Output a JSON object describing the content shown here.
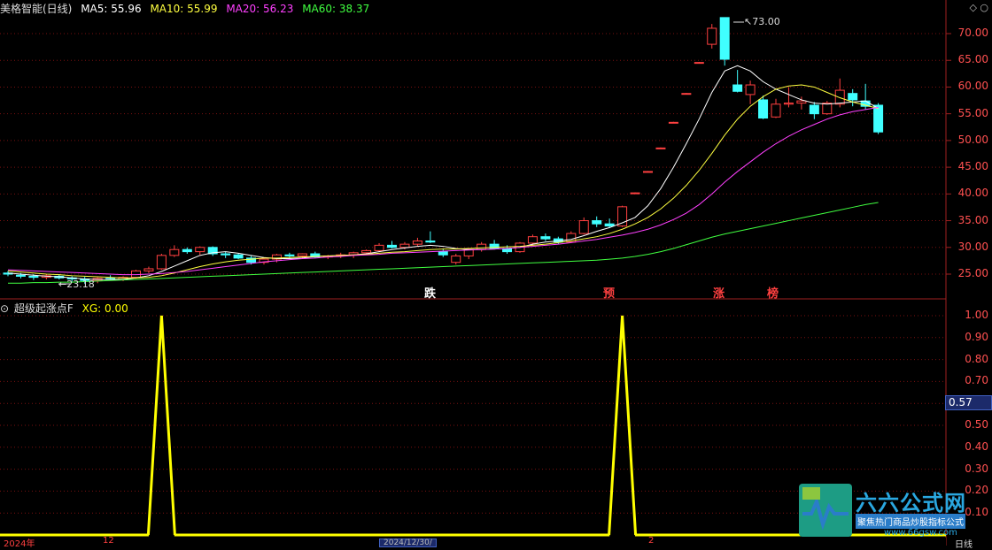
{
  "main_header": {
    "stock_name": "美格智能(日线)",
    "ma5": "MA5: 55.96",
    "ma10": "MA10: 55.99",
    "ma20": "MA20: 56.23",
    "ma60": "MA60: 38.37"
  },
  "sub_header": {
    "indicator": "超级起涨点F",
    "xg": "XG: 0.00"
  },
  "colors": {
    "ma5": "#ffffff",
    "ma10": "#ffff40",
    "ma20": "#ff40ff",
    "ma60": "#40ff40",
    "up": "#ff4040",
    "down": "#40ffff",
    "indicator": "#ffff00",
    "axis": "#ff5050"
  },
  "price_axis": [
    "70.00",
    "65.00",
    "60.00",
    "55.00",
    "50.00",
    "45.00",
    "40.00",
    "35.00",
    "30.00",
    "25.00"
  ],
  "sub_axis": [
    "1.00",
    "0.90",
    "0.80",
    "0.70",
    "0.57",
    "0.50",
    "0.40",
    "0.30",
    "0.20",
    "0.10"
  ],
  "cursor_value": "0.57",
  "high_label": "73.00",
  "low_label": "23.18",
  "annotations": {
    "die": "跌",
    "yu": "预",
    "zhang": "涨",
    "bang": "榜"
  },
  "bottom": {
    "year": "2024年",
    "m12": "12",
    "date": "2024/12/30/",
    "m2": "2",
    "right": "日线"
  },
  "corner": "◇ ○",
  "logo": {
    "title": "六六公式网",
    "sub": "聚焦热门商品炒股指标公式",
    "url": "www.66gsw.com"
  },
  "chart_data": [
    {
      "type": "candlestick",
      "title": "美格智能(日线)",
      "ylim": [
        23,
        73
      ],
      "candles": [
        [
          25.2,
          25.6,
          24.6,
          25.0
        ],
        [
          24.8,
          25.2,
          24.2,
          24.6
        ],
        [
          24.6,
          25.0,
          23.9,
          24.4
        ],
        [
          24.4,
          25.0,
          24.0,
          24.7
        ],
        [
          24.6,
          25.0,
          24.0,
          24.3
        ],
        [
          24.3,
          24.6,
          23.6,
          24.1
        ],
        [
          24.1,
          24.5,
          23.2,
          23.8
        ],
        [
          23.8,
          24.4,
          23.3,
          24.2
        ],
        [
          24.2,
          24.8,
          23.9,
          24.0
        ],
        [
          24.0,
          24.6,
          23.7,
          24.4
        ],
        [
          24.4,
          25.8,
          24.2,
          25.6
        ],
        [
          25.6,
          26.4,
          25.2,
          26.0
        ],
        [
          26.0,
          28.8,
          25.8,
          28.5
        ],
        [
          28.5,
          30.4,
          28.2,
          29.6
        ],
        [
          29.6,
          30.0,
          28.8,
          29.2
        ],
        [
          29.2,
          30.2,
          28.6,
          30.0
        ],
        [
          30.0,
          30.2,
          28.4,
          28.8
        ],
        [
          28.8,
          29.2,
          28.0,
          28.6
        ],
        [
          28.6,
          28.8,
          27.8,
          28.0
        ],
        [
          28.0,
          28.4,
          26.8,
          27.2
        ],
        [
          27.2,
          28.0,
          26.8,
          27.8
        ],
        [
          27.8,
          28.8,
          27.2,
          28.6
        ],
        [
          28.6,
          29.0,
          28.0,
          28.4
        ],
        [
          28.4,
          28.9,
          27.9,
          28.8
        ],
        [
          28.8,
          29.2,
          28.0,
          28.2
        ],
        [
          28.2,
          28.6,
          27.8,
          28.4
        ],
        [
          28.4,
          29.0,
          28.0,
          28.6
        ],
        [
          28.6,
          29.2,
          28.0,
          29.0
        ],
        [
          29.0,
          29.6,
          28.6,
          29.4
        ],
        [
          29.4,
          30.8,
          29.2,
          30.4
        ],
        [
          30.4,
          31.2,
          29.8,
          30.0
        ],
        [
          30.0,
          31.0,
          29.6,
          30.6
        ],
        [
          30.6,
          31.8,
          30.2,
          31.2
        ],
        [
          31.2,
          33.0,
          30.8,
          31.0
        ],
        [
          29.2,
          29.8,
          28.2,
          28.6
        ],
        [
          27.2,
          28.8,
          26.8,
          28.4
        ],
        [
          28.4,
          29.8,
          27.8,
          29.6
        ],
        [
          29.6,
          31.0,
          29.2,
          30.6
        ],
        [
          30.6,
          31.4,
          29.6,
          29.8
        ],
        [
          29.8,
          30.4,
          28.8,
          29.2
        ],
        [
          29.2,
          31.0,
          29.0,
          30.8
        ],
        [
          30.8,
          32.4,
          30.4,
          32.0
        ],
        [
          32.0,
          32.6,
          31.2,
          31.6
        ],
        [
          31.6,
          32.0,
          30.6,
          31.0
        ],
        [
          31.0,
          33.0,
          30.8,
          32.6
        ],
        [
          32.6,
          35.6,
          32.4,
          35.0
        ],
        [
          35.0,
          35.8,
          33.8,
          34.4
        ],
        [
          34.4,
          35.4,
          33.6,
          34.0
        ],
        [
          34.0,
          37.8,
          33.8,
          37.6
        ],
        [
          40.2,
          40.3,
          40.1,
          40.2
        ],
        [
          44.2,
          44.3,
          44.1,
          44.2
        ],
        [
          48.6,
          48.7,
          48.5,
          48.6
        ],
        [
          53.4,
          53.5,
          53.3,
          53.4
        ],
        [
          58.8,
          58.9,
          58.7,
          58.8
        ],
        [
          64.6,
          64.7,
          64.5,
          64.6
        ],
        [
          68.0,
          71.8,
          67.2,
          71.0
        ],
        [
          73.0,
          73.0,
          64.0,
          65.2
        ],
        [
          60.4,
          63.2,
          59.0,
          59.2
        ],
        [
          58.6,
          61.2,
          56.8,
          60.4
        ],
        [
          57.6,
          58.4,
          54.0,
          54.2
        ],
        [
          54.4,
          57.8,
          54.2,
          56.8
        ],
        [
          56.8,
          60.0,
          56.2,
          57.0
        ],
        [
          57.0,
          58.2,
          55.8,
          57.4
        ],
        [
          56.6,
          57.2,
          54.0,
          55.0
        ],
        [
          55.0,
          57.4,
          54.8,
          57.0
        ],
        [
          56.8,
          61.6,
          56.2,
          59.4
        ],
        [
          58.8,
          59.6,
          56.4,
          57.6
        ],
        [
          57.4,
          60.6,
          55.8,
          56.4
        ],
        [
          56.6,
          57.0,
          51.2,
          51.6
        ]
      ],
      "series": [
        {
          "name": "MA5",
          "values": [
            25.2,
            25.0,
            24.8,
            24.6,
            24.5,
            24.3,
            24.1,
            24.0,
            24.0,
            24.0,
            24.3,
            24.7,
            25.5,
            26.5,
            27.5,
            28.5,
            29.0,
            29.2,
            28.9,
            28.5,
            28.1,
            27.9,
            27.9,
            28.0,
            28.3,
            28.4,
            28.5,
            28.6,
            28.8,
            29.2,
            29.6,
            29.9,
            30.2,
            30.4,
            30.2,
            29.8,
            29.6,
            29.6,
            29.7,
            29.8,
            30.0,
            30.6,
            31.0,
            31.2,
            31.5,
            32.2,
            33.0,
            33.7,
            34.6,
            35.6,
            37.8,
            41.0,
            45.0,
            49.4,
            54.0,
            59.0,
            63.0,
            64.0,
            63.0,
            61.0,
            59.6,
            58.6,
            57.6,
            57.0,
            56.8,
            57.0,
            57.2,
            57.4,
            56.0
          ]
        },
        {
          "name": "MA10",
          "values": [
            25.6,
            25.4,
            25.2,
            25.0,
            24.9,
            24.7,
            24.6,
            24.5,
            24.4,
            24.3,
            24.3,
            24.4,
            24.7,
            25.2,
            25.8,
            26.4,
            26.9,
            27.3,
            27.6,
            27.8,
            28.0,
            28.0,
            28.1,
            28.2,
            28.3,
            28.4,
            28.5,
            28.6,
            28.7,
            28.9,
            29.1,
            29.2,
            29.4,
            29.6,
            29.7,
            29.7,
            29.8,
            29.9,
            30.0,
            30.1,
            30.2,
            30.4,
            30.6,
            30.9,
            31.2,
            31.6,
            32.0,
            32.6,
            33.4,
            34.4,
            35.6,
            37.2,
            39.2,
            41.6,
            44.4,
            47.6,
            51.0,
            54.0,
            56.4,
            58.2,
            59.6,
            60.2,
            60.4,
            60.0,
            59.0,
            58.0,
            57.2,
            56.6,
            56.0
          ]
        },
        {
          "name": "MA20",
          "values": [
            25.8,
            25.7,
            25.6,
            25.5,
            25.4,
            25.3,
            25.2,
            25.1,
            25.0,
            24.9,
            24.9,
            25.0,
            25.1,
            25.3,
            25.5,
            25.8,
            26.1,
            26.4,
            26.7,
            27.0,
            27.3,
            27.5,
            27.7,
            27.9,
            28.0,
            28.2,
            28.3,
            28.5,
            28.6,
            28.7,
            28.9,
            29.0,
            29.1,
            29.2,
            29.3,
            29.4,
            29.5,
            29.6,
            29.7,
            29.8,
            30.0,
            30.2,
            30.4,
            30.6,
            30.9,
            31.2,
            31.5,
            31.9,
            32.3,
            32.8,
            33.4,
            34.2,
            35.2,
            36.4,
            38.0,
            40.0,
            42.2,
            44.2,
            46.0,
            47.8,
            49.4,
            50.8,
            52.0,
            53.0,
            54.0,
            54.8,
            55.4,
            55.8,
            56.2
          ]
        },
        {
          "name": "MA60",
          "values": [
            23.3,
            23.3,
            23.4,
            23.4,
            23.5,
            23.5,
            23.6,
            23.7,
            23.8,
            23.9,
            24.0,
            24.1,
            24.2,
            24.3,
            24.4,
            24.5,
            24.6,
            24.7,
            24.8,
            24.9,
            25.0,
            25.1,
            25.2,
            25.3,
            25.4,
            25.5,
            25.6,
            25.7,
            25.8,
            25.9,
            26.0,
            26.1,
            26.2,
            26.3,
            26.4,
            26.5,
            26.6,
            26.7,
            26.8,
            26.9,
            27.0,
            27.1,
            27.2,
            27.3,
            27.4,
            27.5,
            27.6,
            27.8,
            28.0,
            28.3,
            28.7,
            29.2,
            29.8,
            30.5,
            31.2,
            31.9,
            32.5,
            33.0,
            33.5,
            34.0,
            34.5,
            35.0,
            35.5,
            36.0,
            36.5,
            37.0,
            37.5,
            38.0,
            38.4
          ]
        }
      ]
    },
    {
      "type": "line",
      "title": "超级起涨点F",
      "ylim": [
        0,
        1
      ],
      "series": [
        {
          "name": "XG",
          "values": [
            0,
            0,
            0,
            0,
            0,
            0,
            0,
            0,
            0,
            0,
            0,
            0,
            1,
            0,
            0,
            0,
            0,
            0,
            0,
            0,
            0,
            0,
            0,
            0,
            0,
            0,
            0,
            0,
            0,
            0,
            0,
            0,
            0,
            0,
            0,
            0,
            0,
            0,
            0,
            0,
            0,
            0,
            0,
            0,
            0,
            0,
            0,
            0,
            1,
            0,
            0,
            0,
            0,
            0,
            0,
            0,
            0,
            0,
            0,
            0,
            0,
            0,
            0,
            0,
            0,
            0,
            0,
            0,
            0
          ]
        }
      ]
    }
  ]
}
